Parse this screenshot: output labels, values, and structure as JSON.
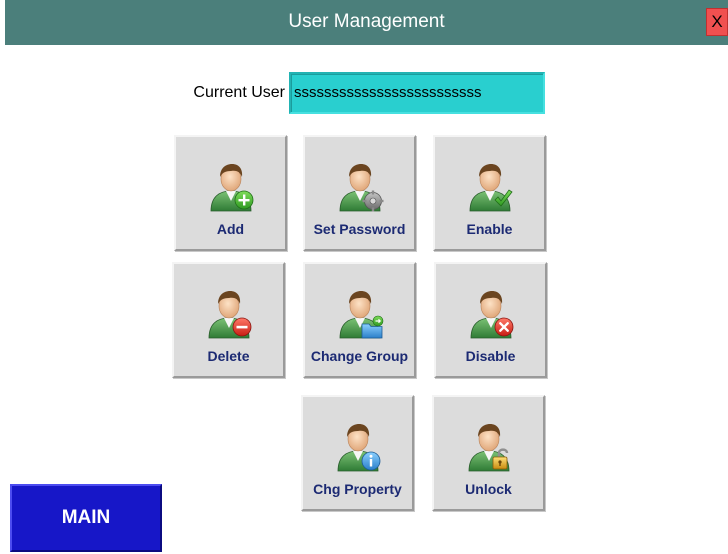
{
  "window": {
    "title": "User Management",
    "close_label": "X"
  },
  "current_user": {
    "label": "Current User",
    "value": "sssssssssssssssssssssssss"
  },
  "actions": [
    {
      "label": "Add",
      "icon": "user-add-icon"
    },
    {
      "label": "Set Password",
      "icon": "user-password-icon"
    },
    {
      "label": "Enable",
      "icon": "user-enable-icon"
    },
    {
      "label": "Delete",
      "icon": "user-delete-icon"
    },
    {
      "label": "Change Group",
      "icon": "user-change-group-icon"
    },
    {
      "label": "Disable",
      "icon": "user-disable-icon"
    },
    {
      "label": "Chg Property",
      "icon": "user-property-icon"
    },
    {
      "label": "Unlock",
      "icon": "user-unlock-icon"
    }
  ],
  "main_button": {
    "label": "MAIN"
  },
  "colors": {
    "titlebar": "#4b7f7b",
    "field": "#29cfcf",
    "button_text": "#1c2a73",
    "main_button": "#1717c8",
    "close_button": "#f05050"
  }
}
